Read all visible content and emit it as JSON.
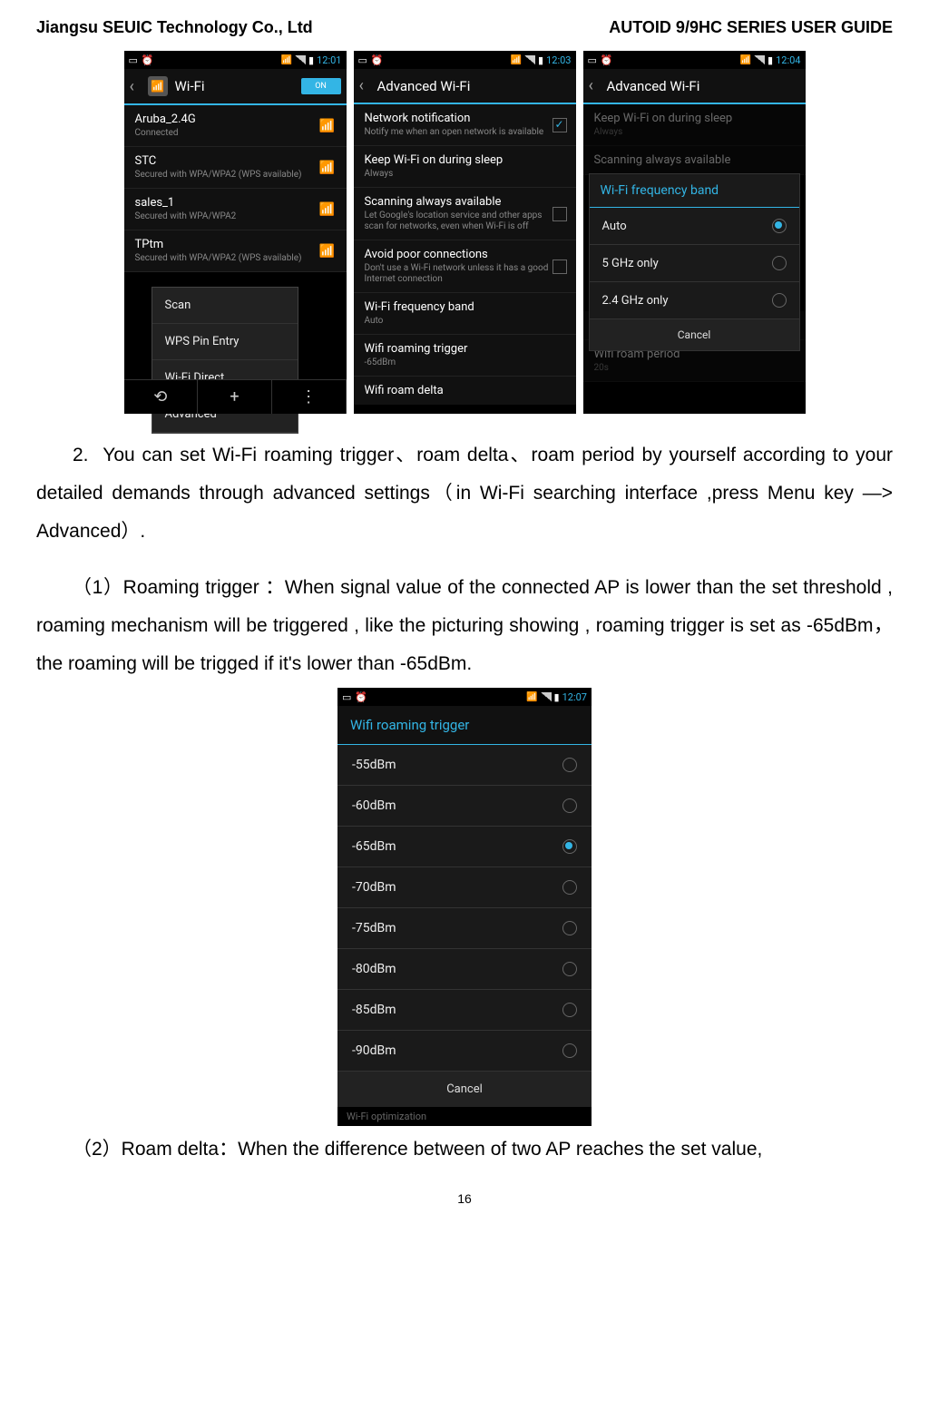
{
  "header": {
    "left": "Jiangsu SEUIC Technology Co., Ltd",
    "right": "AUTOID 9/9HC SERIES USER GUIDE"
  },
  "shot1": {
    "time": "12:01",
    "title": "Wi-Fi",
    "toggle": "ON",
    "items": [
      {
        "title": "Aruba_2.4G",
        "sub": "Connected"
      },
      {
        "title": "STC",
        "sub": "Secured with WPA/WPA2 (WPS available)"
      },
      {
        "title": "sales_1",
        "sub": "Secured with WPA/WPA2"
      },
      {
        "title": "TPtm",
        "sub": "Secured with WPA/WPA2 (WPS available)"
      }
    ],
    "popup": [
      "Scan",
      "WPS Pin Entry",
      "Wi-Fi Direct",
      "Advanced"
    ]
  },
  "shot2": {
    "time": "12:03",
    "title": "Advanced Wi-Fi",
    "items": [
      {
        "title": "Network notification",
        "sub": "Notify me when an open network is available",
        "check": true
      },
      {
        "title": "Keep Wi-Fi on during sleep",
        "sub": "Always"
      },
      {
        "title": "Scanning always available",
        "sub": "Let Google's location service and other apps scan for networks, even when Wi-Fi is off",
        "check": false
      },
      {
        "title": "Avoid poor connections",
        "sub": "Don't use a Wi-Fi network unless it has a good Internet connection",
        "check": false
      },
      {
        "title": "Wi-Fi frequency band",
        "sub": "Auto"
      },
      {
        "title": "Wifi roaming trigger",
        "sub": "-65dBm"
      },
      {
        "title": "Wifi roam delta",
        "sub": ""
      }
    ]
  },
  "shot3": {
    "time": "12:04",
    "title": "Advanced Wi-Fi",
    "bg_items": [
      {
        "title": "Keep Wi-Fi on during sleep",
        "sub": "Always"
      },
      {
        "title": "Scanning always available",
        "sub": ""
      }
    ],
    "dialog_title": "Wi-Fi frequency band",
    "options": [
      {
        "label": "Auto",
        "sel": true
      },
      {
        "label": "5 GHz only",
        "sel": false
      },
      {
        "label": "2.4 GHz only",
        "sel": false
      }
    ],
    "cancel": "Cancel",
    "bg_after": [
      {
        "title": "Wifi roam delta",
        "sub": ""
      },
      {
        "title": "Wifi roam period",
        "sub": "20s"
      }
    ]
  },
  "para1_num": "2.",
  "para1": "You can set Wi-Fi roaming trigger、roam delta、roam period by yourself according to your detailed demands through advanced settings（in Wi-Fi searching interface ,press Menu key —> Advanced）.",
  "para2": "（1）Roaming trigger ：When signal value of the connected AP is lower than the set threshold , roaming mechanism will be triggered , like the picturing showing , roaming trigger is set as -65dBm，the roaming will be trigged if it's lower than -65dBm.",
  "shot4": {
    "time": "12:07",
    "dialog_title": "Wifi roaming trigger",
    "options": [
      {
        "label": "-55dBm",
        "sel": false
      },
      {
        "label": "-60dBm",
        "sel": false
      },
      {
        "label": "-65dBm",
        "sel": true
      },
      {
        "label": "-70dBm",
        "sel": false
      },
      {
        "label": "-75dBm",
        "sel": false
      },
      {
        "label": "-80dBm",
        "sel": false
      },
      {
        "label": "-85dBm",
        "sel": false
      },
      {
        "label": "-90dBm",
        "sel": false
      }
    ],
    "cancel": "Cancel",
    "below": "Wi-Fi optimization"
  },
  "para3": "（2）Roam delta：When the difference between of two AP reaches the set value,",
  "page_number": "16"
}
